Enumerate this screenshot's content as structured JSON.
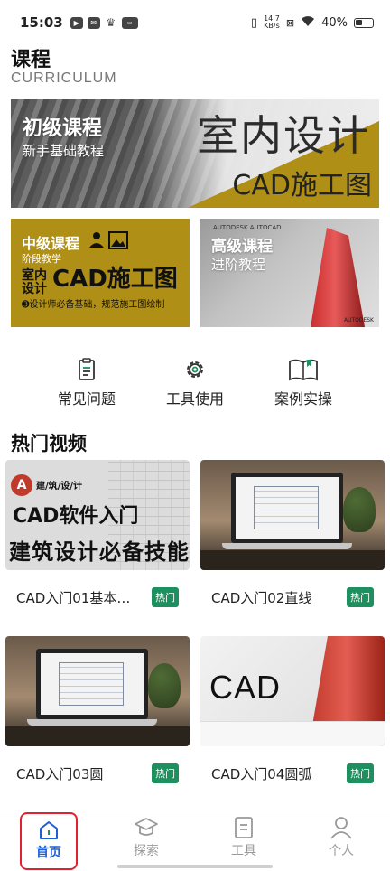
{
  "status_bar": {
    "time": "15:03",
    "speed_value": "14.7",
    "speed_unit": "KB/s",
    "battery": "40%"
  },
  "header": {
    "title": "课程",
    "subtitle": "CURRICULUM"
  },
  "banners": {
    "main": {
      "level": "初级课程",
      "desc": "新手基础教程",
      "big_title": "室内设计",
      "big_sub": "CAD施工图"
    },
    "mid": {
      "level": "中级课程",
      "desc": "阶段教学",
      "side_text": "室内设计",
      "big_title": "CAD施工图",
      "note": "➌设计师必备基础，规范施工图绘制"
    },
    "adv": {
      "brand_top": "AUTODESK AUTOCAD",
      "level": "高级课程",
      "desc": "进阶教程",
      "brand_bottom": "AUTODESK"
    }
  },
  "quick_links": [
    {
      "label": "常见问题",
      "icon": "clipboard-icon"
    },
    {
      "label": "工具使用",
      "icon": "gear-icon"
    },
    {
      "label": "案例实操",
      "icon": "book-icon"
    }
  ],
  "section": {
    "title": "热门视频",
    "hot_label": "热门"
  },
  "videos": [
    {
      "name": "CAD入门01基本…",
      "thumb_tag": "建/筑/设/计",
      "thumb_line1": "CAD软件入门",
      "thumb_line2": "建筑设计必备技能",
      "thumb_logo": "A"
    },
    {
      "name": "CAD入门02直线"
    },
    {
      "name": "CAD入门03圆"
    },
    {
      "name": "CAD入门04圆弧",
      "thumb_text": "CAD"
    }
  ],
  "bottom_nav": [
    {
      "label": "首页",
      "icon": "home-icon",
      "active": true
    },
    {
      "label": "探索",
      "icon": "graduation-cap-icon",
      "active": false
    },
    {
      "label": "工具",
      "icon": "document-icon",
      "active": false
    },
    {
      "label": "个人",
      "icon": "person-icon",
      "active": false
    }
  ],
  "colors": {
    "accent_green": "#1e8f5e",
    "gold": "#b08f16",
    "active_outline": "#e0212e",
    "nav_active_text": "#1f5fd6",
    "nav_inactive": "#999999"
  }
}
